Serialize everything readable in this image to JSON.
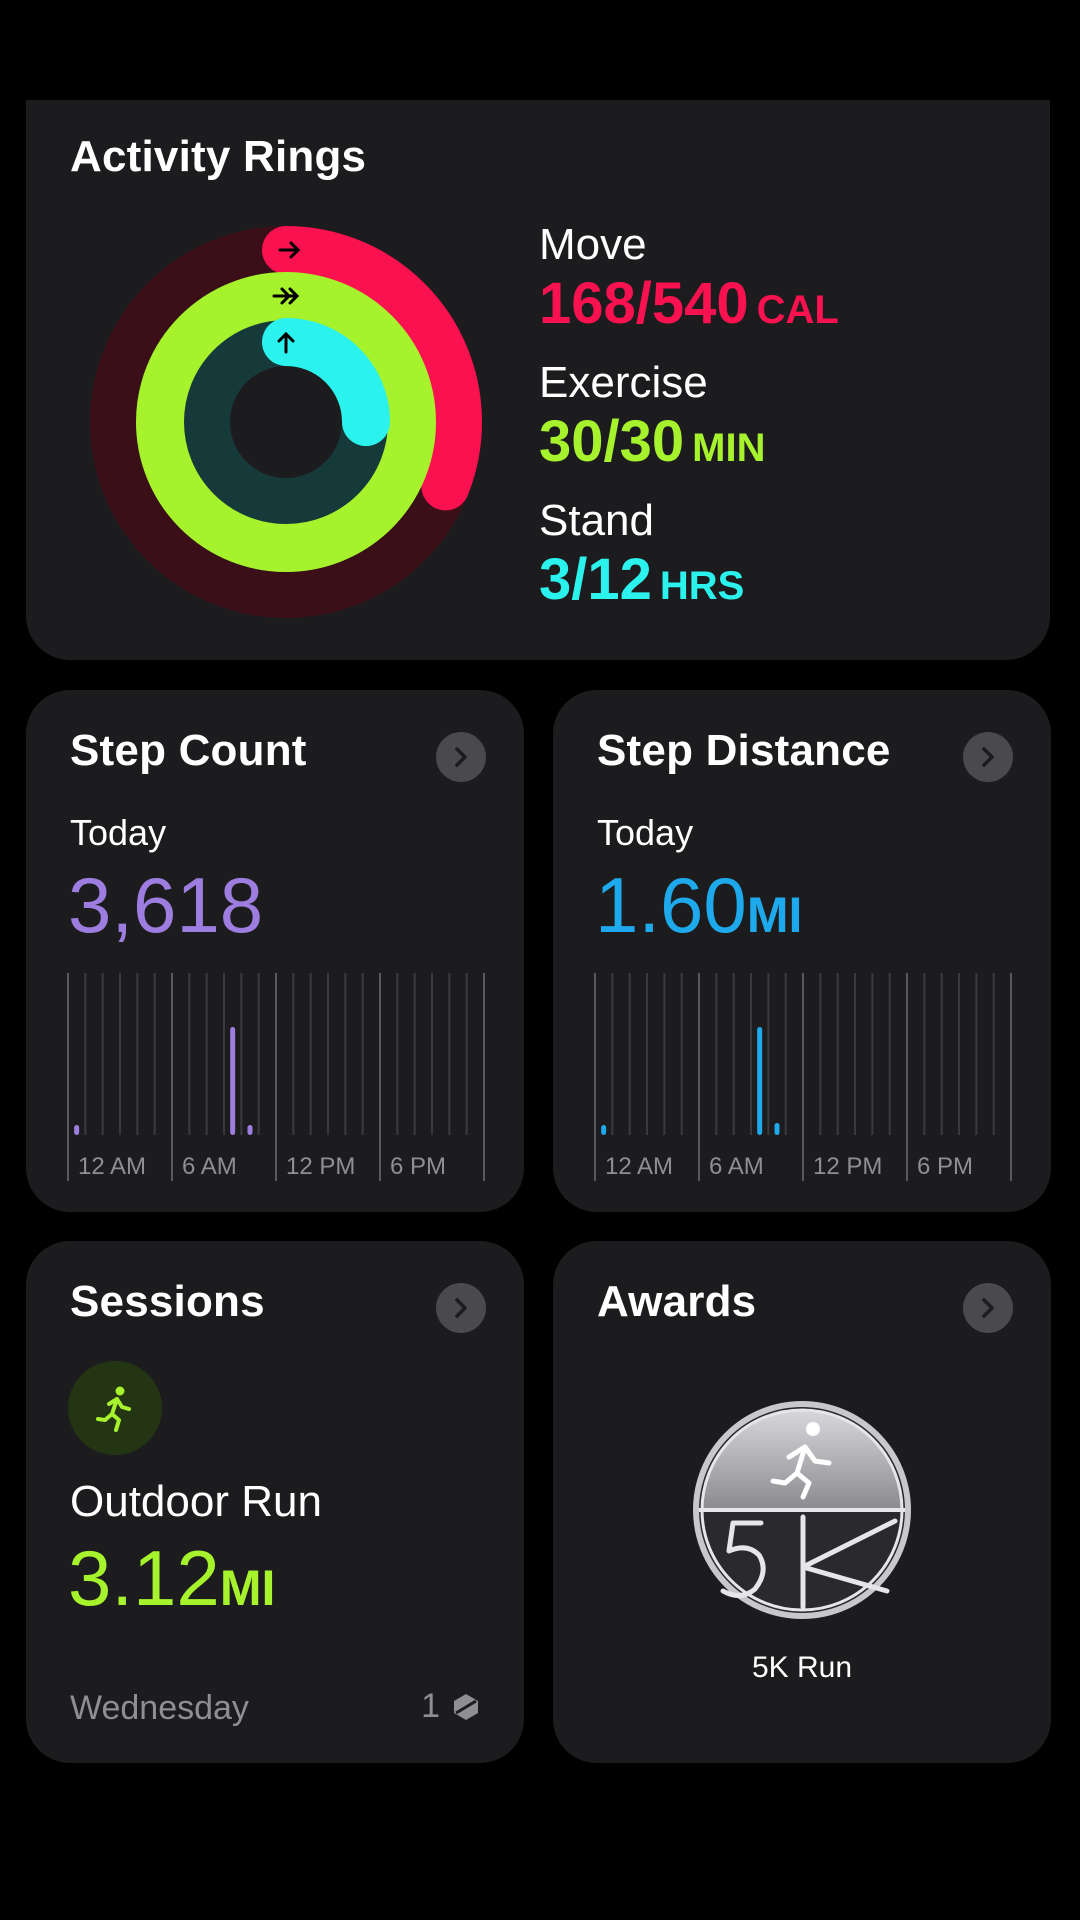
{
  "rings": {
    "title": "Activity Rings",
    "move": {
      "label": "Move",
      "value": "168/540",
      "unit": "CAL",
      "progress": 0.311,
      "color": "#fa114f"
    },
    "exercise": {
      "label": "Exercise",
      "value": "30/30",
      "unit": "MIN",
      "progress": 1.0,
      "color": "#a6f22c"
    },
    "stand": {
      "label": "Stand",
      "value": "3/12",
      "unit": "HRS",
      "progress": 0.25,
      "color": "#2bf2ec"
    }
  },
  "steps": {
    "title": "Step Count",
    "period": "Today",
    "value": "3,618",
    "color": "#9d7ee0",
    "tick_labels": [
      "12 AM",
      "6 AM",
      "12 PM",
      "6 PM"
    ]
  },
  "distance": {
    "title": "Step Distance",
    "period": "Today",
    "value": "1.60",
    "unit": "MI",
    "color": "#1ea9ec",
    "tick_labels": [
      "12 AM",
      "6 AM",
      "12 PM",
      "6 PM"
    ]
  },
  "sessions": {
    "title": "Sessions",
    "activity_icon": "running-figure-icon",
    "workout": "Outdoor Run",
    "value": "3.12",
    "unit": "MI",
    "day": "Wednesday",
    "count": "1"
  },
  "awards": {
    "title": "Awards",
    "medal_icon": "5k-run-medal-icon",
    "award": "5K Run"
  },
  "chart_data": [
    {
      "type": "bar",
      "title": "Step Count",
      "x": [
        "12 AM",
        "1 AM",
        "2 AM",
        "3 AM",
        "4 AM",
        "5 AM",
        "6 AM",
        "7 AM",
        "8 AM",
        "9 AM",
        "10 AM",
        "11 AM",
        "12 PM",
        "1 PM",
        "2 PM",
        "3 PM",
        "4 PM",
        "5 PM",
        "6 PM",
        "7 PM",
        "8 PM",
        "9 PM",
        "10 PM",
        "11 PM"
      ],
      "values": [
        120,
        0,
        0,
        0,
        0,
        0,
        0,
        0,
        0,
        2900,
        250,
        0,
        0,
        0,
        0,
        0,
        0,
        0,
        0,
        0,
        0,
        0,
        0,
        0
      ],
      "tick_labels": [
        "12 AM",
        "6 AM",
        "12 PM",
        "6 PM"
      ]
    },
    {
      "type": "bar",
      "title": "Step Distance",
      "x": [
        "12 AM",
        "1 AM",
        "2 AM",
        "3 AM",
        "4 AM",
        "5 AM",
        "6 AM",
        "7 AM",
        "8 AM",
        "9 AM",
        "10 AM",
        "11 AM",
        "12 PM",
        "1 PM",
        "2 PM",
        "3 PM",
        "4 PM",
        "5 PM",
        "6 PM",
        "7 PM",
        "8 PM",
        "9 PM",
        "10 PM",
        "11 PM"
      ],
      "values": [
        0.05,
        0,
        0,
        0,
        0,
        0,
        0,
        0,
        0,
        1.35,
        0.15,
        0,
        0,
        0,
        0,
        0,
        0,
        0,
        0,
        0,
        0,
        0,
        0,
        0
      ],
      "tick_labels": [
        "12 AM",
        "6 AM",
        "12 PM",
        "6 PM"
      ]
    }
  ]
}
